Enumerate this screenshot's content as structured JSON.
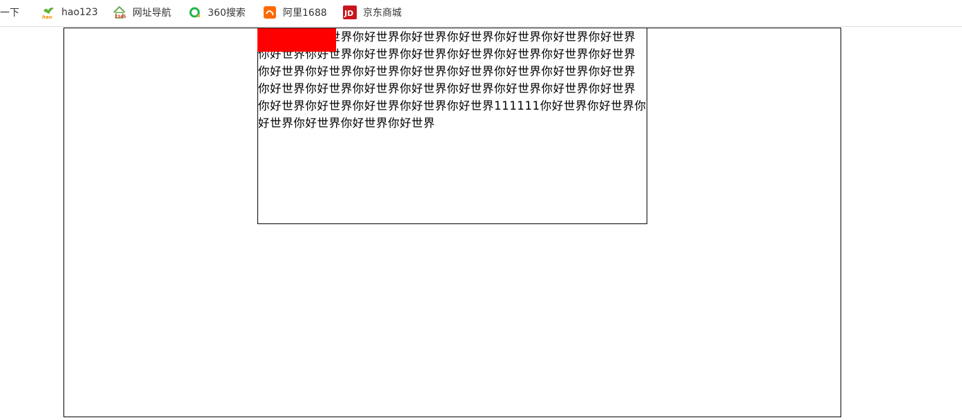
{
  "bookmarks": [
    {
      "label": "度一下",
      "icon": "baidu-icon"
    },
    {
      "label": "hao123",
      "icon": "hao123-icon"
    },
    {
      "label": "网址导航",
      "icon": "2345-icon"
    },
    {
      "label": "360搜索",
      "icon": "360-search-icon"
    },
    {
      "label": "阿里1688",
      "icon": "alibaba-1688-icon"
    },
    {
      "label": "京东商城",
      "icon": "jd-icon"
    }
  ],
  "content": {
    "paragraph": "你好世界你好世界你好世界你好世界你好世界你好世界你好世界你好世界你好世界你好世界你好世界你好世界你好世界你好世界你好世界你好世界你好世界你好世界你好世界你好世界你好世界你好世界你好世界你好世界你好世界你好世界你好世界你好世界你好世界你好世界你好世界你好世界你好世界你好世界你好世界你好世界你好世界111111你好世界你好世界你好世界你好世界你好世界你好世界"
  },
  "colors": {
    "red_block": "#ff0000",
    "border": "#000000",
    "hao123_green": "#5cb531",
    "icon_1688_orange": "#ff6a00",
    "jd_red": "#c8161d",
    "search_360_green": "#21b34a"
  }
}
